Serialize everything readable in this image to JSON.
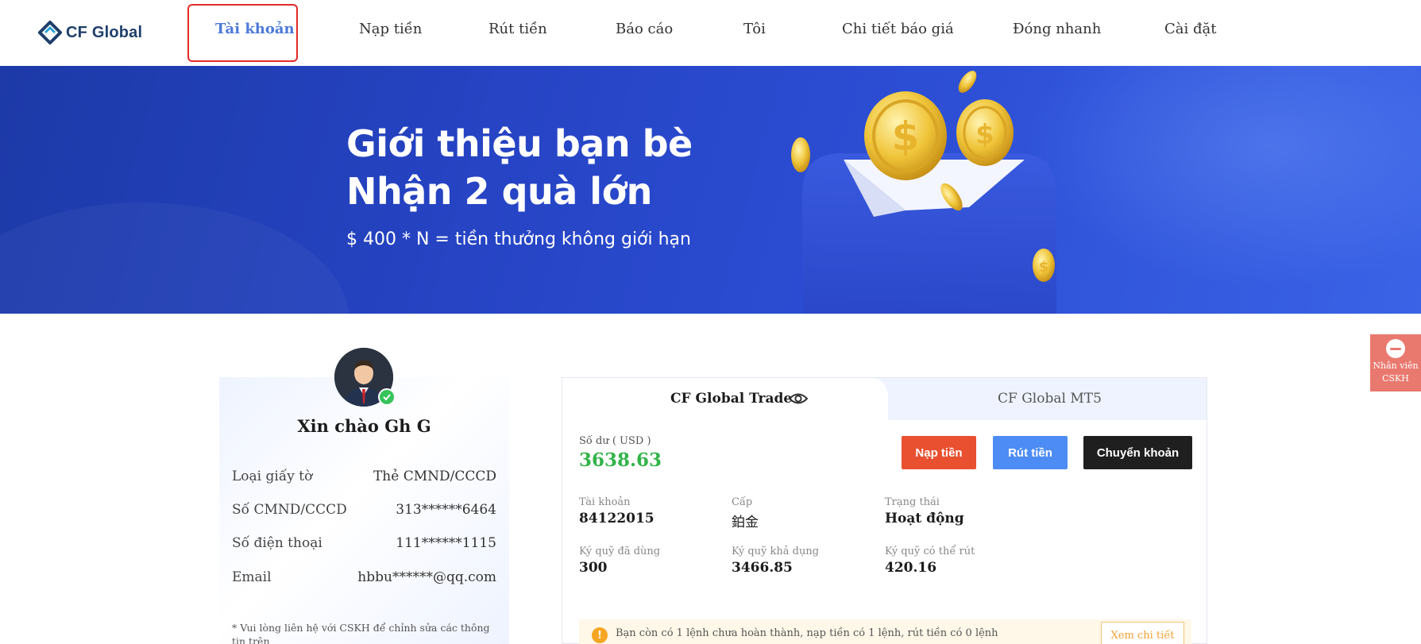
{
  "brand": {
    "name": "CF Global"
  },
  "nav": {
    "items": [
      {
        "label": "Tài khoản",
        "active": true
      },
      {
        "label": "Nạp tiền"
      },
      {
        "label": "Rút tiền"
      },
      {
        "label": "Báo cáo"
      },
      {
        "label": "Tôi"
      },
      {
        "label": "Chi tiết báo giá"
      },
      {
        "label": "Đóng nhanh"
      },
      {
        "label": "Cài đặt"
      }
    ]
  },
  "banner": {
    "line1": "Giới thiệu bạn bè",
    "line2": "Nhận 2 quà lớn",
    "subtitle": "$ 400 * N = tiền thưởng không giới hạn"
  },
  "profile": {
    "greeting": "Xin chào Gh G",
    "rows": [
      {
        "key": "Loại giấy tờ",
        "value": "Thẻ CMND/CCCD"
      },
      {
        "key": "Số CMND/CCCD",
        "value": "313******6464"
      },
      {
        "key": "Số điện thoại",
        "value": "111******1115"
      },
      {
        "key": "Email",
        "value": "hbbu******@qq.com"
      }
    ],
    "note": "* Vui lòng liên hệ với CSKH để chỉnh sửa các thông tin trên"
  },
  "account": {
    "tabs": [
      {
        "label": "CF Global Trade",
        "active": true
      },
      {
        "label": "CF Global MT5"
      }
    ],
    "balance_label": "Số dư ( USD )",
    "balance_value": "3638.63",
    "buttons": {
      "deposit": "Nạp tiền",
      "withdraw": "Rút tiền",
      "transfer": "Chuyển khoản"
    },
    "stats": [
      {
        "label": "Tài khoản",
        "value": "84122015"
      },
      {
        "label": "Cấp",
        "value": "鉑金"
      },
      {
        "label": "Trạng thái",
        "value": "Hoạt động"
      },
      {
        "label": "Ký quỹ đã dùng",
        "value": "300"
      },
      {
        "label": "Ký quỹ khả dụng",
        "value": "3466.85"
      },
      {
        "label": "Ký quỹ có thể rút",
        "value": "420.16"
      }
    ],
    "alert_text": "Bạn còn có 1 lệnh chưa hoàn thành, nạp tiền có 1 lệnh, rút tiền có 0 lệnh",
    "alert_button": "Xem chi tiết"
  },
  "support": {
    "line1": "Nhân viên",
    "line2": "CSKH"
  },
  "colors": {
    "accent": "#4d79d8",
    "banner": "#2644c4",
    "balance": "#33b44a",
    "deposit": "#e8502f",
    "withdraw": "#4d8cf5",
    "transfer": "#1f1f1f",
    "highlight": "#e52a2a"
  },
  "icons": [
    "logo-icon",
    "coin-icon",
    "eye-icon",
    "verified-badge-icon",
    "warning-icon",
    "chat-icon"
  ]
}
